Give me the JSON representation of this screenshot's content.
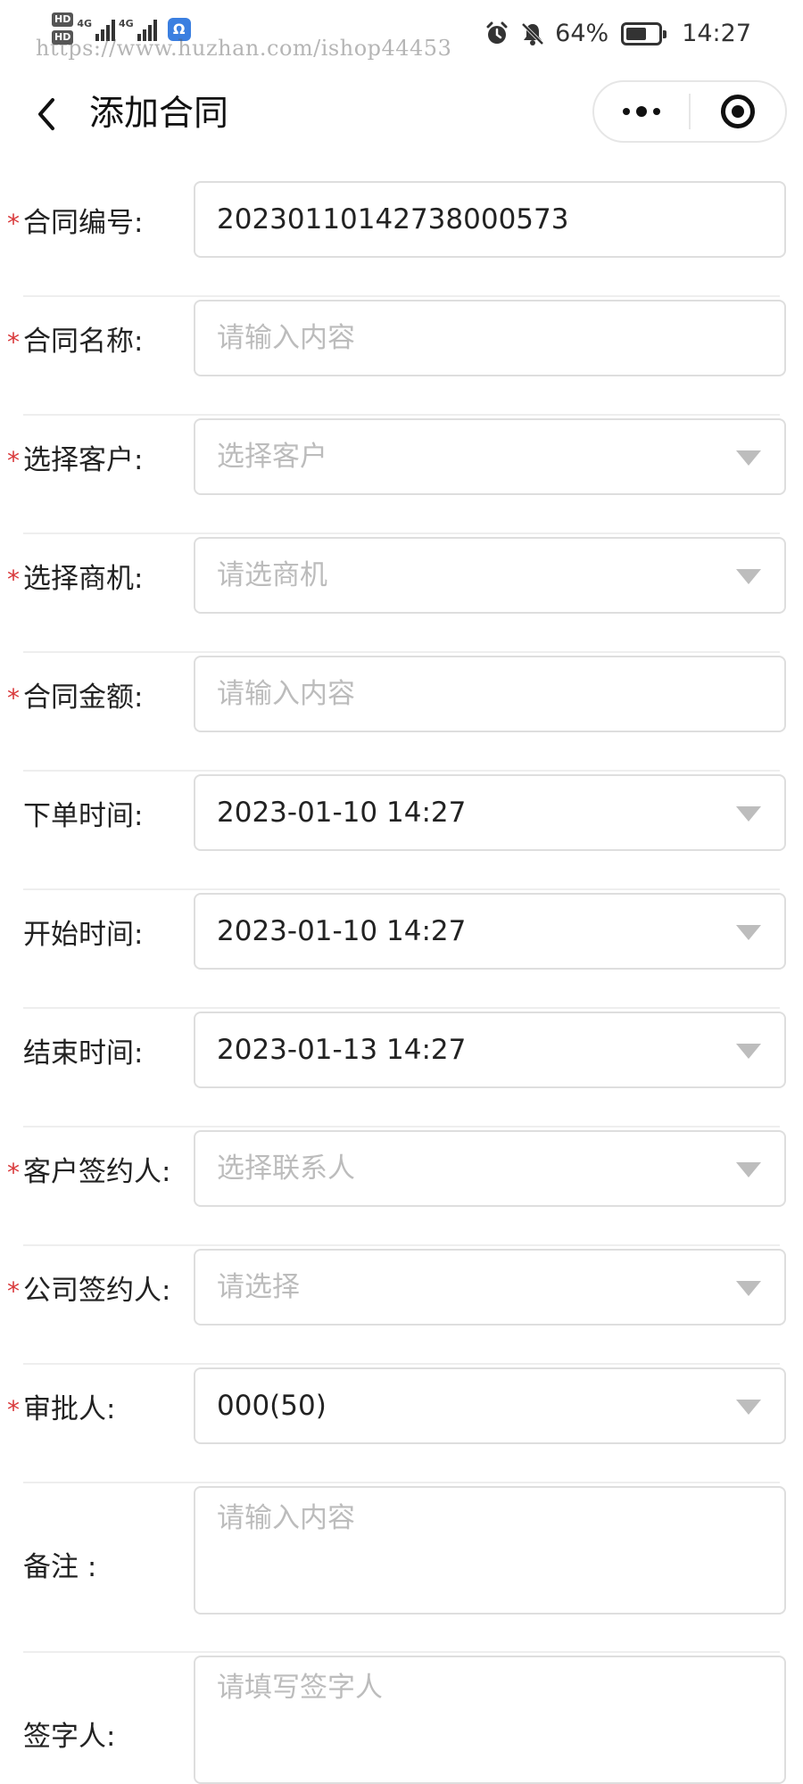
{
  "status_bar": {
    "hd1": "HD",
    "hd2": "HD",
    "net1": "4G",
    "net2": "4G",
    "app_badge": "Ω",
    "watermark": "https://www.huzhan.com/ishop44453",
    "battery": "64%",
    "battery_level": 0.64,
    "time": "14:27",
    "icons": [
      "alarm-icon",
      "mute-bell-icon",
      "battery-icon"
    ]
  },
  "nav": {
    "title": "添加合同",
    "back_icon": "chevron-left-icon",
    "more_icon": "more-dots-icon",
    "close_icon": "target-circle-icon"
  },
  "form": {
    "contract_no": {
      "label": "合同编号:",
      "value": "20230110142738000573",
      "required": true
    },
    "contract_name": {
      "label": "合同名称:",
      "placeholder": "请输入内容",
      "required": true
    },
    "customer": {
      "label": "选择客户:",
      "placeholder": "选择客户",
      "required": true
    },
    "opportunity": {
      "label": "选择商机:",
      "placeholder": "请选商机",
      "required": true
    },
    "amount": {
      "label": "合同金额:",
      "placeholder": "请输入内容",
      "required": true
    },
    "order_time": {
      "label": "下单时间:",
      "value": "2023-01-10 14:27",
      "required": false
    },
    "start_time": {
      "label": "开始时间:",
      "value": "2023-01-10 14:27",
      "required": false
    },
    "end_time": {
      "label": "结束时间:",
      "value": "2023-01-13 14:27",
      "required": false
    },
    "customer_signer": {
      "label": "客户签约人:",
      "placeholder": "选择联系人",
      "required": true
    },
    "company_signer": {
      "label": "公司签约人:",
      "placeholder": "请选择",
      "required": true
    },
    "approver": {
      "label": "审批人:",
      "value": "000(50)",
      "required": true
    },
    "remark": {
      "label": "备注 :",
      "placeholder": "请输入内容",
      "required": false
    },
    "signer": {
      "label": "签字人:",
      "placeholder": "请填写签字人",
      "required": false
    },
    "required_mark": "*",
    "dropdown_icon": "caret-down-icon"
  }
}
